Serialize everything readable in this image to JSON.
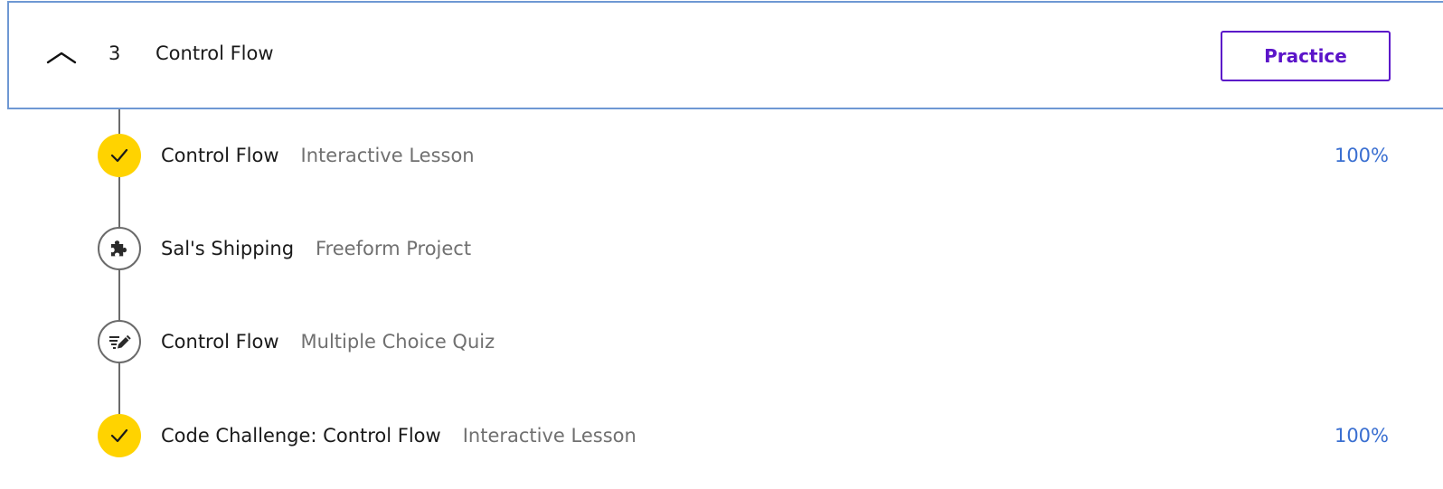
{
  "section": {
    "number": "3",
    "title": "Control Flow",
    "collapse_icon": "chevron-up-icon",
    "practice_label": "Practice"
  },
  "colors": {
    "header_border": "#6e98d3",
    "practice_purple": "#5b14c9",
    "complete_yellow": "#ffd300",
    "progress_blue": "#3a6fd1",
    "timeline_gray": "#6a6a6a"
  },
  "items": [
    {
      "title": "Control Flow",
      "type": "Interactive Lesson",
      "progress": "100%",
      "status": "complete",
      "icon": "checkmark-icon"
    },
    {
      "title": "Sal's Shipping",
      "type": "Freeform Project",
      "progress": "",
      "status": "incomplete",
      "icon": "puzzle-piece-icon"
    },
    {
      "title": "Control Flow",
      "type": "Multiple Choice Quiz",
      "progress": "",
      "status": "incomplete",
      "icon": "quiz-pencil-icon"
    },
    {
      "title": "Code Challenge: Control Flow",
      "type": "Interactive Lesson",
      "progress": "100%",
      "status": "complete",
      "icon": "checkmark-icon"
    }
  ]
}
